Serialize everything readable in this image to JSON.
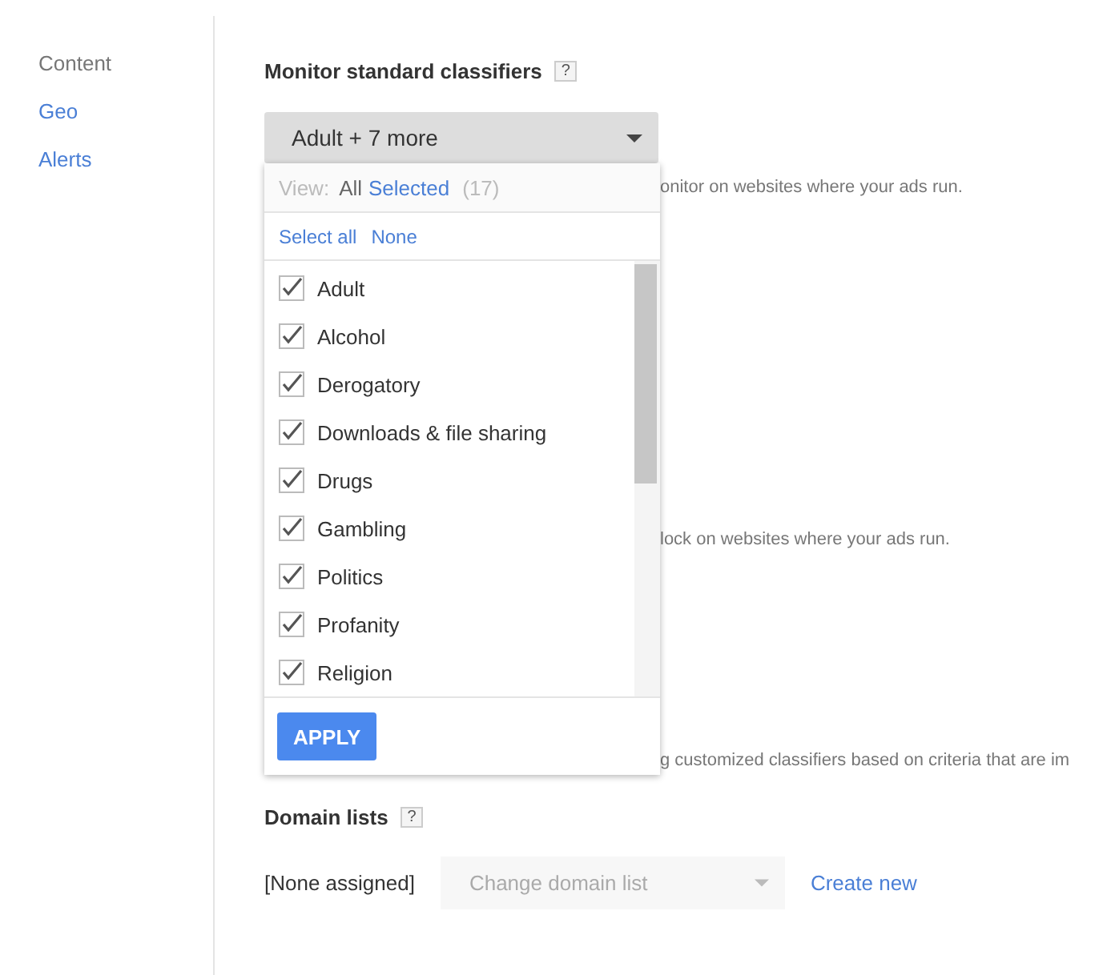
{
  "sidebar": {
    "items": [
      {
        "label": "Content",
        "selected": true
      },
      {
        "label": "Geo",
        "selected": false
      },
      {
        "label": "Alerts",
        "selected": false
      }
    ]
  },
  "monitor": {
    "title": "Monitor standard classifiers",
    "help": "?",
    "dropdown": {
      "value": "Adult + 7 more"
    },
    "descriptions": [
      "onitor on websites where your ads run.",
      "lock on websites where your ads run.",
      "g customized classifiers based on criteria that are im"
    ]
  },
  "popup": {
    "view_label": "View:",
    "view_options": [
      {
        "label": "All",
        "selected": true
      },
      {
        "label": "Selected",
        "selected": false
      }
    ],
    "count": "(17)",
    "select_all": "Select all",
    "none": "None",
    "items": [
      {
        "label": "Adult",
        "checked": true
      },
      {
        "label": "Alcohol",
        "checked": true
      },
      {
        "label": "Derogatory",
        "checked": true
      },
      {
        "label": "Downloads & file sharing",
        "checked": true
      },
      {
        "label": "Drugs",
        "checked": true
      },
      {
        "label": "Gambling",
        "checked": true
      },
      {
        "label": "Politics",
        "checked": true
      },
      {
        "label": "Profanity",
        "checked": true
      },
      {
        "label": "Religion",
        "checked": true
      }
    ],
    "apply": "APPLY"
  },
  "domain_lists": {
    "title": "Domain lists",
    "help": "?",
    "assigned": "[None assigned]",
    "dropdown": {
      "placeholder": "Change domain list"
    },
    "create": "Create new"
  }
}
